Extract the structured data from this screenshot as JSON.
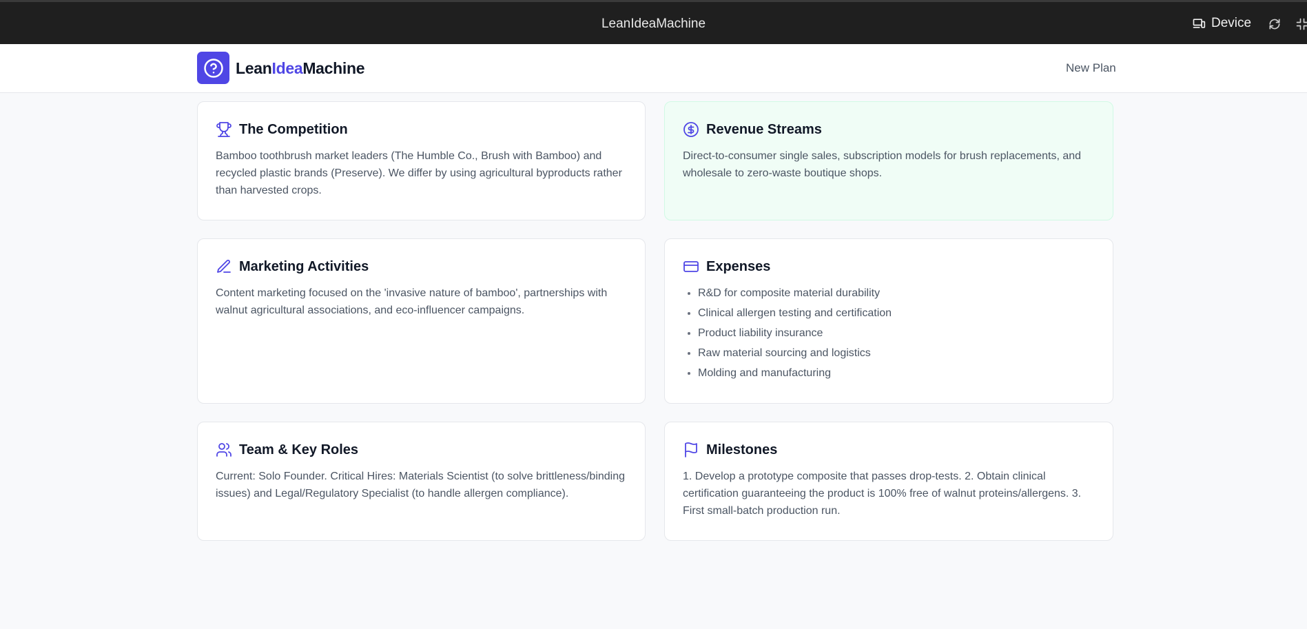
{
  "browser": {
    "title": "LeanIdeaMachine",
    "device_label": "Device",
    "icons": [
      "device-icon",
      "rotate-icon",
      "fullscreen-icon"
    ]
  },
  "header": {
    "logo_icon": "question-circle-icon",
    "brand_part1": "Lean",
    "brand_part2": "Idea",
    "brand_part3": "Machine",
    "new_plan_label": "New Plan",
    "accent_color": "#4f46e5"
  },
  "cards": {
    "competition": {
      "icon": "trophy-icon",
      "title": "The Competition",
      "text": "Bamboo toothbrush market leaders (The Humble Co., Brush with Bamboo) and recycled plastic brands (Preserve). We differ by using agricultural byproducts rather than harvested crops."
    },
    "revenue": {
      "icon": "dollar-circle-icon",
      "title": "Revenue Streams",
      "text": "Direct-to-consumer single sales, subscription models for brush replacements, and wholesale to zero-waste boutique shops."
    },
    "marketing": {
      "icon": "pencil-icon",
      "title": "Marketing Activities",
      "text": "Content marketing focused on the 'invasive nature of bamboo', partnerships with walnut agricultural associations, and eco-influencer campaigns."
    },
    "expenses": {
      "icon": "credit-card-icon",
      "title": "Expenses",
      "items": [
        "R&D for composite material durability",
        "Clinical allergen testing and certification",
        "Product liability insurance",
        "Raw material sourcing and logistics",
        "Molding and manufacturing"
      ]
    },
    "team": {
      "icon": "users-icon",
      "title": "Team & Key Roles",
      "text": "Current: Solo Founder. Critical Hires: Materials Scientist (to solve brittleness/binding issues) and Legal/Regulatory Specialist (to handle allergen compliance)."
    },
    "milestones": {
      "icon": "flag-icon",
      "title": "Milestones",
      "text": "1. Develop a prototype composite that passes drop-tests. 2. Obtain clinical certification guaranteeing the product is 100% free of walnut proteins/allergens. 3. First small-batch production run."
    }
  }
}
